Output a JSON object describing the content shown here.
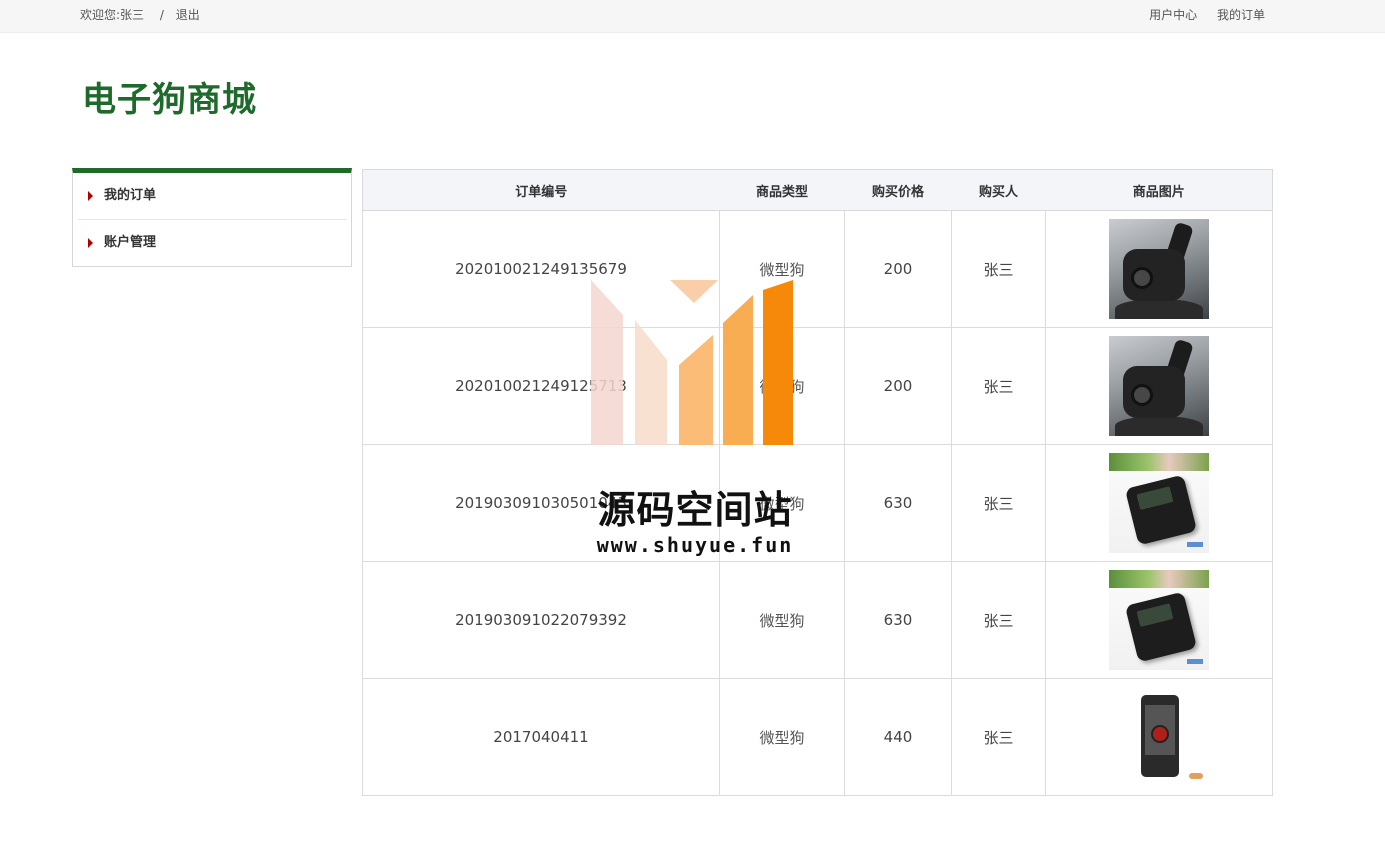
{
  "topbar": {
    "welcome": "欢迎您:张三",
    "separator": "/",
    "logout": "退出",
    "user_center": "用户中心",
    "my_orders": "我的订单"
  },
  "brand": {
    "title": "电子狗商城",
    "color": "#1d6a2a"
  },
  "sidebar": {
    "items": [
      {
        "label": "我的订单",
        "icon": "arrow-right-icon"
      },
      {
        "label": "账户管理",
        "icon": "arrow-right-icon"
      }
    ]
  },
  "table": {
    "headers": [
      "订单编号",
      "商品类型",
      "购买价格",
      "购买人",
      "商品图片"
    ],
    "rows": [
      {
        "order_no": "202010021249135679",
        "type": "微型狗",
        "price": "200",
        "buyer": "张三",
        "image": "dashcam-image"
      },
      {
        "order_no": "202010021249125713",
        "type": "微型狗",
        "price": "200",
        "buyer": "张三",
        "image": "dashcam-image"
      },
      {
        "order_no": "201903091030501043",
        "type": "微型狗",
        "price": "630",
        "buyer": "张三",
        "image": "camera-image"
      },
      {
        "order_no": "201903091022079392",
        "type": "微型狗",
        "price": "630",
        "buyer": "张三",
        "image": "camera-image"
      },
      {
        "order_no": "2017040411",
        "type": "微型狗",
        "price": "440",
        "buyer": "张三",
        "image": "phone-image"
      }
    ]
  },
  "watermark": {
    "title": "源码空间站",
    "url": "www.shuyue.fun",
    "colors": [
      "#f5d6d0",
      "#f8c9a0",
      "#f9a94a",
      "#f7890a"
    ]
  }
}
